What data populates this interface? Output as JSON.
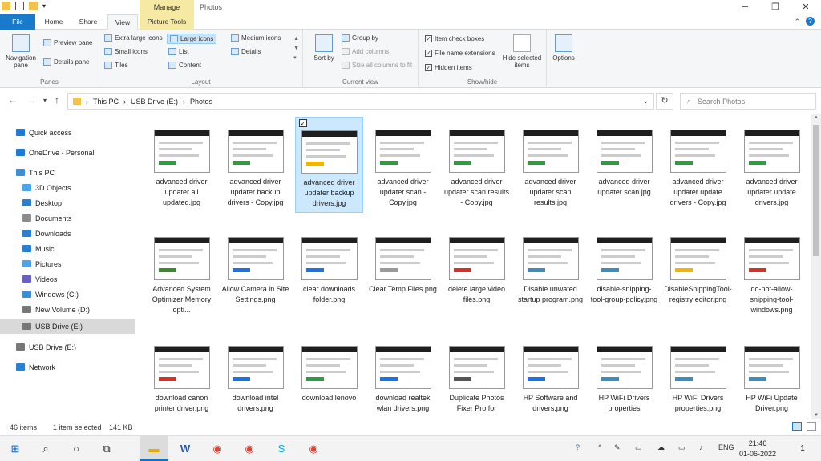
{
  "window": {
    "title": "Photos",
    "manage": "Manage",
    "min": "─",
    "max": "❐",
    "close": "✕"
  },
  "tabs": {
    "file": "File",
    "home": "Home",
    "share": "Share",
    "view": "View",
    "picture_tools": "Picture Tools"
  },
  "ribbon": {
    "panes": {
      "navigation": "Navigation pane",
      "preview": "Preview pane",
      "details": "Details pane",
      "label": "Panes"
    },
    "layout": {
      "extra_large": "Extra large icons",
      "large": "Large icons",
      "medium": "Medium icons",
      "small": "Small icons",
      "list": "List",
      "details": "Details",
      "tiles": "Tiles",
      "content": "Content",
      "label": "Layout"
    },
    "current_view": {
      "sort": "Sort by",
      "group": "Group by",
      "add_columns": "Add columns",
      "size_all": "Size all columns to fit",
      "label": "Current view"
    },
    "show_hide": {
      "item_check": "Item check boxes",
      "extensions": "File name extensions",
      "hidden": "Hidden items",
      "hide_selected": "Hide selected items",
      "label": "Show/hide"
    },
    "options": "Options"
  },
  "address": {
    "path": [
      "This PC",
      "USB Drive (E:)",
      "Photos"
    ],
    "search_placeholder": "Search Photos"
  },
  "sidebar": [
    {
      "label": "Quick access",
      "color": "#1f7ad3"
    },
    {
      "label": "OneDrive - Personal",
      "color": "#1f7ad3"
    },
    {
      "label": "This PC",
      "color": "#3a8fd9"
    },
    {
      "label": "3D Objects",
      "color": "#4aa6e8"
    },
    {
      "label": "Desktop",
      "color": "#2b7fd1"
    },
    {
      "label": "Documents",
      "color": "#8c8c8c"
    },
    {
      "label": "Downloads",
      "color": "#2b7fd1"
    },
    {
      "label": "Music",
      "color": "#2b7fd1"
    },
    {
      "label": "Pictures",
      "color": "#4aa6e8"
    },
    {
      "label": "Videos",
      "color": "#6b5fc4"
    },
    {
      "label": "Windows (C:)",
      "color": "#3a8fd9"
    },
    {
      "label": "New Volume (D:)",
      "color": "#777"
    },
    {
      "label": "USB Drive (E:)",
      "color": "#777"
    },
    {
      "label": "USB Drive (E:)",
      "color": "#777"
    },
    {
      "label": "Network",
      "color": "#2b7fd1"
    }
  ],
  "files": [
    {
      "name": "advanced driver updater all updated.jpg",
      "accent": "#2e9c3f"
    },
    {
      "name": "advanced driver updater backup drivers - Copy.jpg",
      "accent": "#2e9c3f"
    },
    {
      "name": "advanced driver updater backup drivers.jpg",
      "accent": "#f4b400"
    },
    {
      "name": "advanced driver updater scan - Copy.jpg",
      "accent": "#2e9c3f"
    },
    {
      "name": "advanced driver updater scan results - Copy.jpg",
      "accent": "#2e9c3f"
    },
    {
      "name": "advanced driver updater scan results.jpg",
      "accent": "#2e9c3f"
    },
    {
      "name": "advanced driver updater scan.jpg",
      "accent": "#2e9c3f"
    },
    {
      "name": "advanced driver updater update drivers - Copy.jpg",
      "accent": "#2e9c3f"
    },
    {
      "name": "advanced driver updater update drivers.jpg",
      "accent": "#2e9c3f"
    },
    {
      "name": "Advanced System Optimizer Memory opti...",
      "accent": "#3b8b2e"
    },
    {
      "name": "Allow Camera in Site Settings.png",
      "accent": "#1a73e8"
    },
    {
      "name": "clear downloads folder.png",
      "accent": "#1a73e8"
    },
    {
      "name": "Clear Temp Files.png",
      "accent": "#999999"
    },
    {
      "name": "delete large video files.png",
      "accent": "#d93025"
    },
    {
      "name": "Disable unwated startup program.png",
      "accent": "#3c8dbc"
    },
    {
      "name": "disable-snipping-tool-group-policy.png",
      "accent": "#3c8dbc"
    },
    {
      "name": "DisableSnippingTool-registry editor.png",
      "accent": "#f4b400"
    },
    {
      "name": "do-not-allow-snipping-tool-windows.png",
      "accent": "#d93025"
    },
    {
      "name": "download canon printer driver.png",
      "accent": "#d93025"
    },
    {
      "name": "download intel drivers.png",
      "accent": "#1a73e8"
    },
    {
      "name": "download lenovo",
      "accent": "#2e9c3f"
    },
    {
      "name": "download realtek wlan drivers.png",
      "accent": "#1a73e8"
    },
    {
      "name": "Duplicate Photos Fixer Pro for",
      "accent": "#555555"
    },
    {
      "name": "HP Software and drivers.png",
      "accent": "#1a73e8"
    },
    {
      "name": "HP WiFi Drivers properties",
      "accent": "#3c8dbc"
    },
    {
      "name": "HP WiFi Drivers properties.png",
      "accent": "#3c8dbc"
    },
    {
      "name": "HP WiFi Update Driver.png",
      "accent": "#3c8dbc"
    }
  ],
  "status": {
    "count": "46 items",
    "selected": "1 item selected",
    "size": "141 KB"
  },
  "taskbar": {
    "lang": "ENG",
    "time": "21:46",
    "date": "01-06-2022",
    "notif": "1"
  }
}
